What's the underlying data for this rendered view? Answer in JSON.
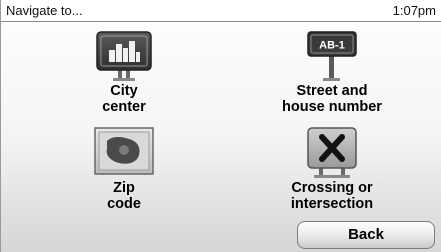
{
  "header": {
    "title": "Navigate to...",
    "time": "1:07pm"
  },
  "menu": {
    "items": [
      {
        "id": "city",
        "label_lines": [
          "City",
          "center"
        ],
        "icon": "city-skyline-sign-icon"
      },
      {
        "id": "street",
        "label_lines": [
          "Street and",
          "house number"
        ],
        "icon": "street-sign-icon",
        "sign_text": "AB-1"
      },
      {
        "id": "zip",
        "label_lines": [
          "Zip",
          "code"
        ],
        "icon": "map-area-icon"
      },
      {
        "id": "crossing",
        "label_lines": [
          "Crossing or",
          "intersection"
        ],
        "icon": "crossing-x-sign-icon"
      }
    ]
  },
  "footer": {
    "back_label": "Back"
  }
}
